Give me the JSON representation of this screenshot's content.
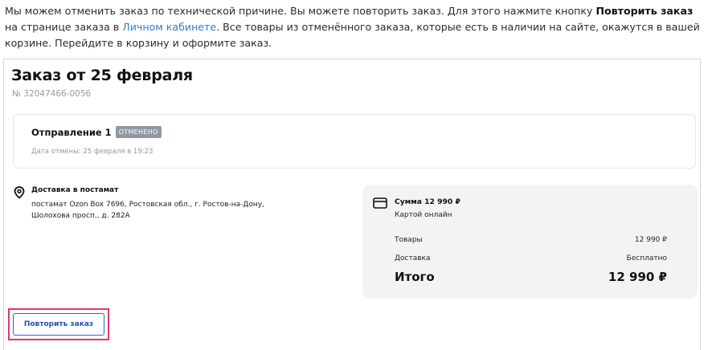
{
  "intro": {
    "part1": "Мы можем отменить заказ по технической причине. Вы можете повторить заказ. Для этого нажмите кнопку ",
    "bold": "Повторить заказ",
    "part2": " на странице заказа в ",
    "link": "Личном кабинете",
    "part3": ". Все товары из отменённого заказа, которые есть в наличии на сайте, окажутся в вашей корзине. Перейдите в корзину и оформите заказ."
  },
  "order": {
    "title": "Заказ от 25 февраля",
    "number": "№ 32047466-0056"
  },
  "shipment": {
    "title": "Отправление 1",
    "status": "ОТМЕНЕНО",
    "cancel_date": "Дата отмены: 25 февраля в 19:23"
  },
  "delivery": {
    "icon": "map-pin-icon",
    "title": "Доставка в постамат",
    "address": "постамат Ozon Box 7696, Ростовская обл., г. Ростов-на-Дону, Шолохова просп., д. 282А"
  },
  "summary": {
    "icon": "credit-card-icon",
    "title": "Сумма 12 990 ₽",
    "method": "Картой онлайн",
    "goods_label": "Товары",
    "goods_value": "12 990 ₽",
    "delivery_label": "Доставка",
    "delivery_value": "Бесплатно",
    "total_label": "Итого",
    "total_value": "12 990 ₽"
  },
  "actions": {
    "repeat_label": "Повторить заказ"
  },
  "colors": {
    "link": "#2a7fd4",
    "badge": "#8f98a3",
    "button": "#2a63d9",
    "highlight": "#e2386a"
  }
}
